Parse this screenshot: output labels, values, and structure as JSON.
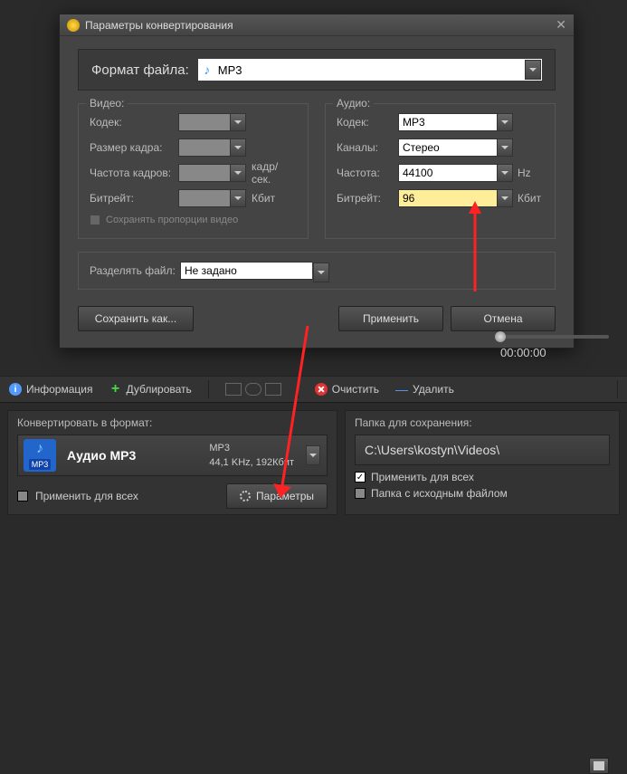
{
  "dialog": {
    "title": "Параметры конвертирования",
    "format_label": "Формат файла:",
    "format_value": "MP3",
    "video": {
      "legend": "Видео:",
      "codec_label": "Кодек:",
      "framesize_label": "Размер кадра:",
      "framerate_label": "Частота кадров:",
      "framerate_unit": "кадр/сек.",
      "bitrate_label": "Битрейт:",
      "bitrate_unit": "Кбит",
      "keep_aspect": "Сохранять пропорции видео"
    },
    "audio": {
      "legend": "Аудио:",
      "codec_label": "Кодек:",
      "codec_value": "MP3",
      "channels_label": "Каналы:",
      "channels_value": "Стерео",
      "rate_label": "Частота:",
      "rate_value": "44100",
      "rate_unit": "Hz",
      "bitrate_label": "Битрейт:",
      "bitrate_value": "96",
      "bitrate_unit": "Кбит"
    },
    "split_label": "Разделять файл:",
    "split_value": "Не задано",
    "save_as": "Сохранить как...",
    "apply": "Применить",
    "cancel": "Отмена"
  },
  "toolbar": {
    "info": "Информация",
    "duplicate": "Дублировать",
    "clear": "Очистить",
    "delete": "Удалить"
  },
  "time": "00:00:00",
  "convert_panel": {
    "title": "Конвертировать в формат:",
    "badge": "MP3",
    "name": "Аудио MP3",
    "line1": "MP3",
    "line2": "44,1 KHz, 192Кбит",
    "apply_all": "Применить для всех",
    "params_btn": "Параметры"
  },
  "save_panel": {
    "title": "Папка для сохранения:",
    "path": "C:\\Users\\kostyn\\Videos\\",
    "apply_all": "Применить для всех",
    "same_folder": "Папка с исходным файлом"
  }
}
